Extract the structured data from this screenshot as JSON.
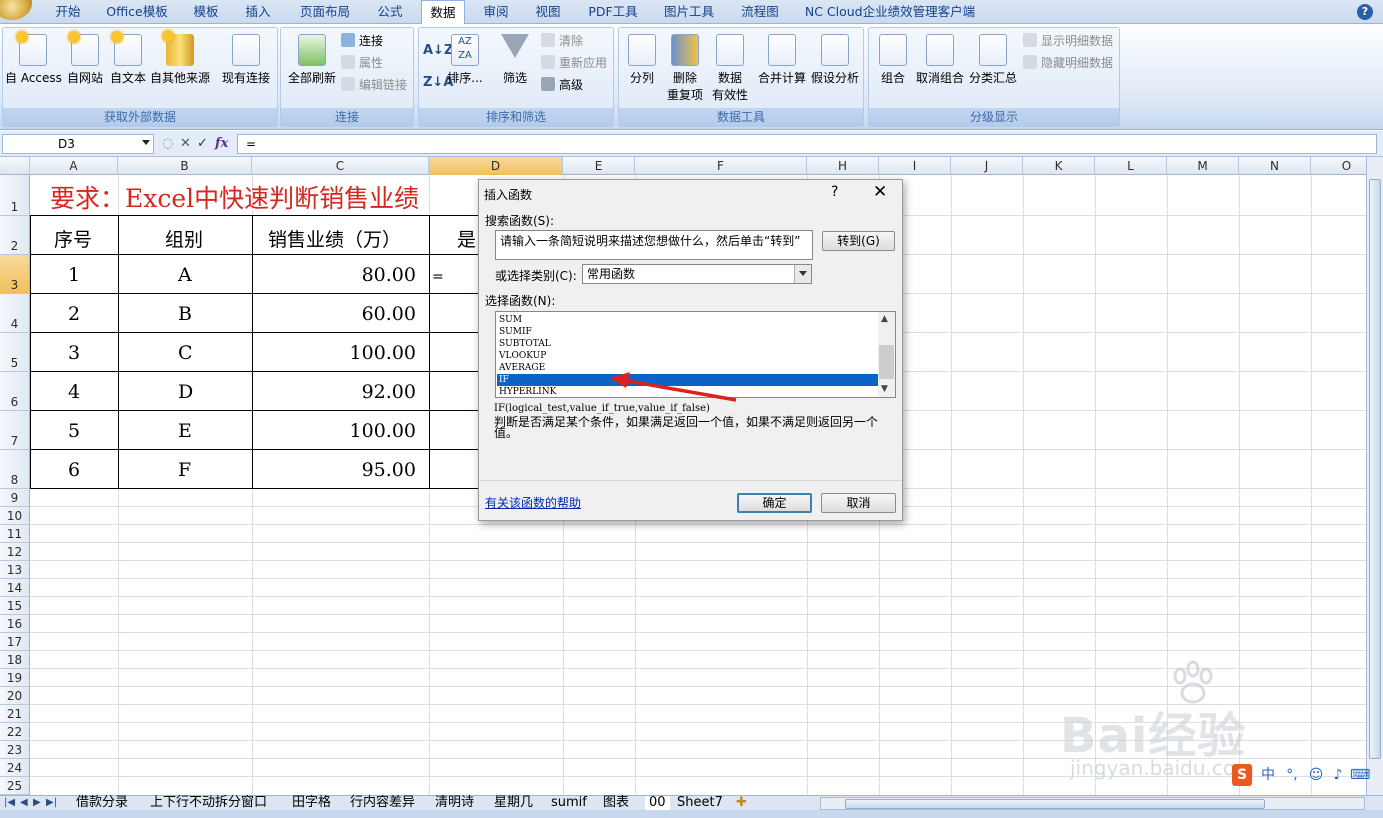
{
  "ribbon": {
    "tabs": [
      "开始",
      "Office模板",
      "模板",
      "插入",
      "页面布局",
      "公式",
      "数据",
      "审阅",
      "视图",
      "PDF工具",
      "图片工具",
      "流程图",
      "NC Cloud企业绩效管理客户端"
    ],
    "active_tab": "数据",
    "groups": {
      "external": {
        "label": "获取外部数据",
        "buttons": [
          "自 Access",
          "自网站",
          "自文本",
          "自其他来源",
          "现有连接"
        ]
      },
      "connections": {
        "label": "连接",
        "refresh_all": "全部刷新",
        "connect": "连接",
        "properties": "属性",
        "edit_links": "编辑链接"
      },
      "sort_filter": {
        "label": "排序和筛选",
        "sort": "排序...",
        "filter": "筛选",
        "clear": "清除",
        "reapply": "重新应用",
        "advanced": "高级"
      },
      "data_tools": {
        "label": "数据工具",
        "split": "分列",
        "remove_dup_1": "删除",
        "remove_dup_2": "重复项",
        "validation_1": "数据",
        "validation_2": "有效性",
        "consolidate": "合并计算",
        "whatif": "假设分析"
      },
      "outline": {
        "label": "分级显示",
        "group": "组合",
        "ungroup": "取消组合",
        "subtotal": "分类汇总",
        "show_detail": "显示明细数据",
        "hide_detail": "隐藏明细数据"
      }
    }
  },
  "formula_bar": {
    "name_box": "D3",
    "fx": "fx",
    "content": "="
  },
  "grid": {
    "columns": [
      "A",
      "B",
      "C",
      "D",
      "E",
      "F",
      "H",
      "I",
      "J",
      "K",
      "L",
      "M",
      "N",
      "O"
    ],
    "rows": [
      "1",
      "2",
      "3",
      "4",
      "5",
      "6",
      "7",
      "8",
      "9",
      "10",
      "11",
      "12",
      "13",
      "14",
      "15",
      "16",
      "17",
      "18",
      "19",
      "20",
      "21",
      "22",
      "23",
      "24",
      "25"
    ],
    "title": "要求：Excel中快速判断销售业绩",
    "headers": [
      "序号",
      "组别",
      "销售业绩（万）",
      "是"
    ],
    "table": [
      {
        "no": "1",
        "group": "A",
        "sales": "80.00"
      },
      {
        "no": "2",
        "group": "B",
        "sales": "60.00"
      },
      {
        "no": "3",
        "group": "C",
        "sales": "100.00"
      },
      {
        "no": "4",
        "group": "D",
        "sales": "92.00"
      },
      {
        "no": "5",
        "group": "E",
        "sales": "100.00"
      },
      {
        "no": "6",
        "group": "F",
        "sales": "95.00"
      }
    ],
    "active_cell_value": "="
  },
  "sheet_tabs": [
    "借款分录",
    "上下行不动拆分窗口",
    "田字格",
    "行内容差异",
    "清明诗",
    "星期几",
    "sumif",
    "图表",
    "00",
    "Sheet7"
  ],
  "dialog": {
    "title": "插入函数",
    "help_q": "?",
    "close": "✕",
    "search_label": "搜索函数(S):",
    "search_placeholder": "请输入一条简短说明来描述您想做什么，然后单击“转到”",
    "go_button": "转到(G)",
    "category_label": "或选择类别(C):",
    "category_value": "常用函数",
    "select_label": "选择函数(N):",
    "functions": [
      "SUM",
      "SUMIF",
      "SUBTOTAL",
      "VLOOKUP",
      "AVERAGE",
      "IF",
      "HYPERLINK"
    ],
    "selected_function": "IF",
    "signature": "IF(logical_test,value_if_true,value_if_false)",
    "description": "判断是否满足某个条件，如果满足返回一个值，如果不满足则返回另一个值。",
    "help_link": "有关该函数的帮助",
    "ok": "确定",
    "cancel": "取消"
  },
  "watermark": {
    "text": "Bai经验",
    "sub": "jingyan.baidu.com"
  },
  "colors": {
    "title_red": "#d7261e",
    "selection_blue": "#0a64c8",
    "arrow_red": "#e0201c"
  }
}
